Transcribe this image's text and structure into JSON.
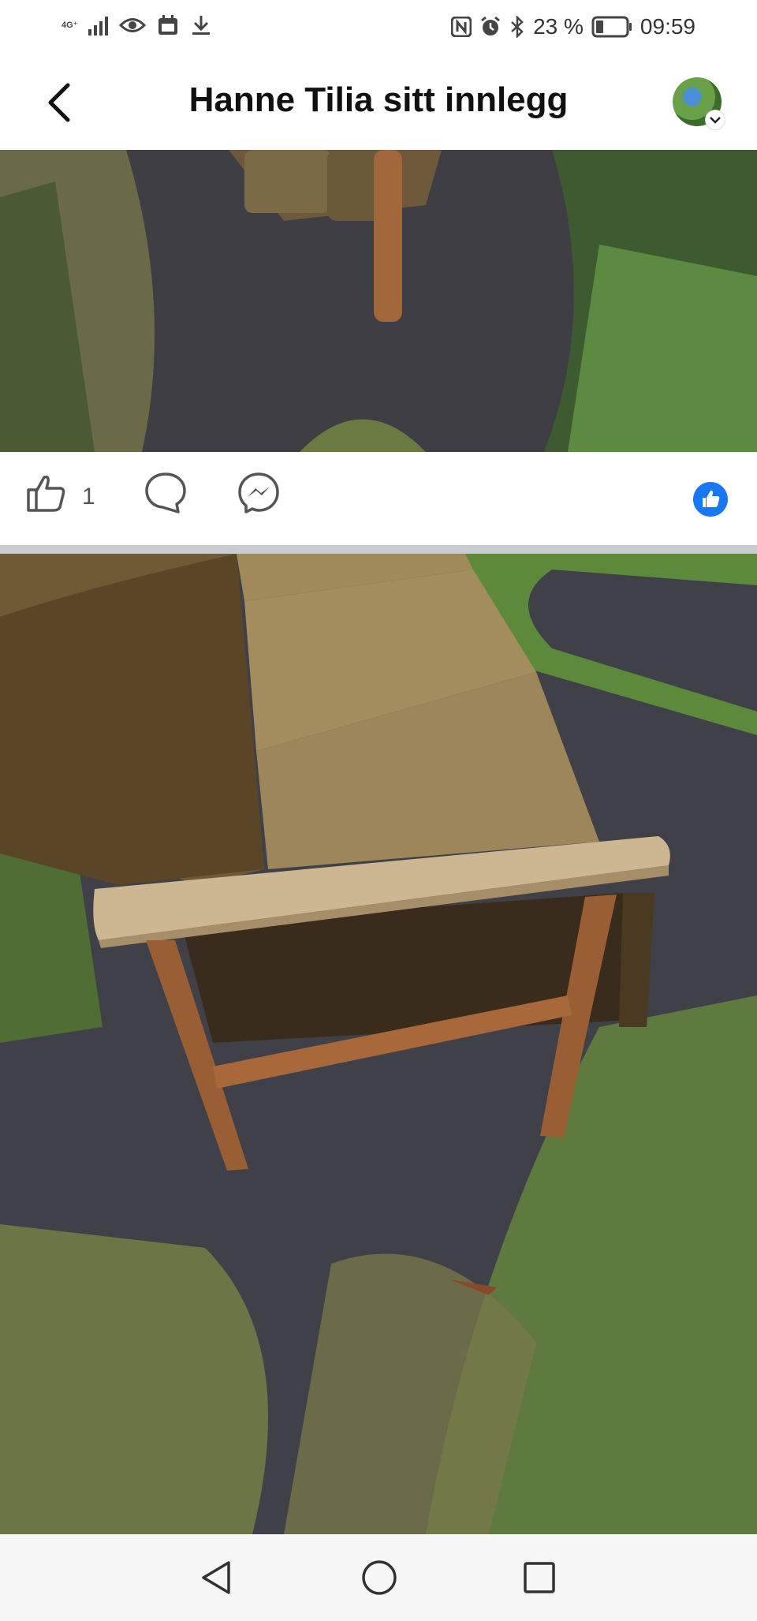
{
  "status_bar": {
    "network": "4G⁺",
    "battery": "23 %",
    "time": "09:59"
  },
  "header": {
    "title": "Hanne Tilia sitt innlegg"
  },
  "actions": {
    "like_count": "1"
  },
  "colors": {
    "accent": "#1877f2",
    "separator": "#c9ccd1"
  },
  "icons": {
    "back": "chevron-left-icon",
    "like": "thumbs-up-icon",
    "comment": "comment-bubble-icon",
    "messenger": "messenger-icon",
    "reaction": "like-reaction-icon",
    "nav_back": "triangle-back-icon",
    "nav_home": "circle-home-icon",
    "nav_recent": "square-recent-icon"
  }
}
